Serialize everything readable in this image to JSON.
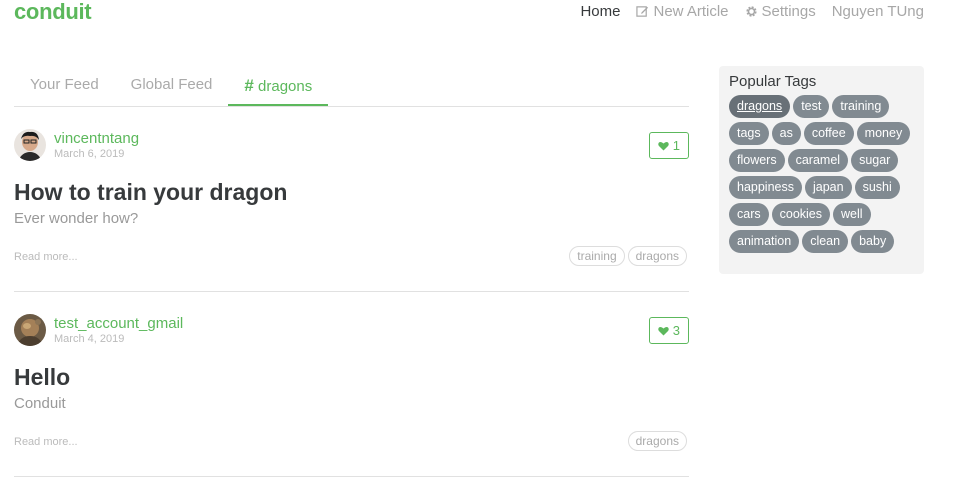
{
  "navbar": {
    "brand": "conduit",
    "links": [
      {
        "label": "Home",
        "icon": ""
      },
      {
        "label": "New Article",
        "icon": "edit-icon"
      },
      {
        "label": "Settings",
        "icon": "gear-icon"
      },
      {
        "label": "Nguyen TUng",
        "icon": ""
      }
    ]
  },
  "feed": {
    "tabs": [
      "Your Feed",
      "Global Feed",
      "dragons"
    ],
    "active_tab_hash": "#"
  },
  "articles": [
    {
      "author": "vincentntang",
      "date": "March 6, 2019",
      "favorites": "1",
      "title": "How to train your dragon",
      "description": "Ever wonder how?",
      "read_more": "Read more...",
      "tags": [
        "training",
        "dragons"
      ]
    },
    {
      "author": "test_account_gmail",
      "date": "March 4, 2019",
      "favorites": "3",
      "title": "Hello",
      "description": "Conduit",
      "read_more": "Read more...",
      "tags": [
        "dragons"
      ]
    }
  ],
  "sidebar": {
    "title": "Popular Tags",
    "tags": [
      "dragons",
      "test",
      "training",
      "tags",
      "as",
      "coffee",
      "money",
      "flowers",
      "caramel",
      "sugar",
      "happiness",
      "japan",
      "sushi",
      "cars",
      "cookies",
      "well",
      "animation",
      "clean",
      "baby"
    ]
  },
  "colors": {
    "brand": "#5cb85c",
    "tag_bg": "#818a91",
    "sidebar_bg": "#f3f3f3"
  }
}
